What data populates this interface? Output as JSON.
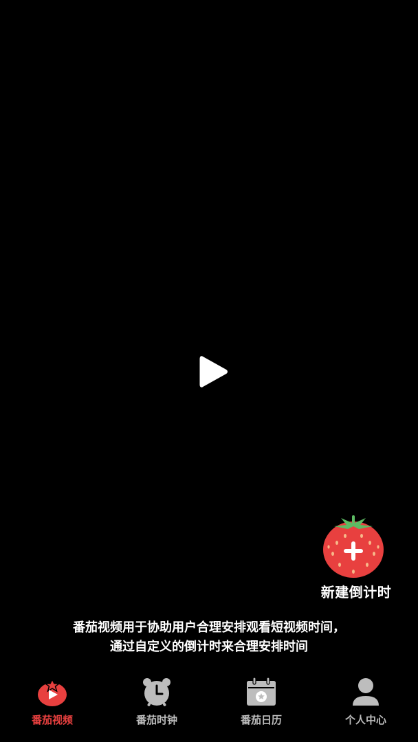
{
  "fab": {
    "label": "新建倒计时",
    "icon": "tomato-plus-icon"
  },
  "description": {
    "line1": "番茄视频用于协助用户合理安排观看短视频时间，",
    "line2": "通过自定义的倒计时来合理安排时间"
  },
  "tabs": [
    {
      "label": "番茄视频",
      "icon": "tomato-play-icon",
      "active": true
    },
    {
      "label": "番茄时钟",
      "icon": "alarm-clock-icon",
      "active": false
    },
    {
      "label": "番茄日历",
      "icon": "calendar-icon",
      "active": false
    },
    {
      "label": "个人中心",
      "icon": "person-icon",
      "active": false
    }
  ],
  "colors": {
    "background": "#000000",
    "accent": "#e8403f",
    "tab_inactive": "#bdbdbd",
    "tomato_leaf": "#5dbb63"
  }
}
